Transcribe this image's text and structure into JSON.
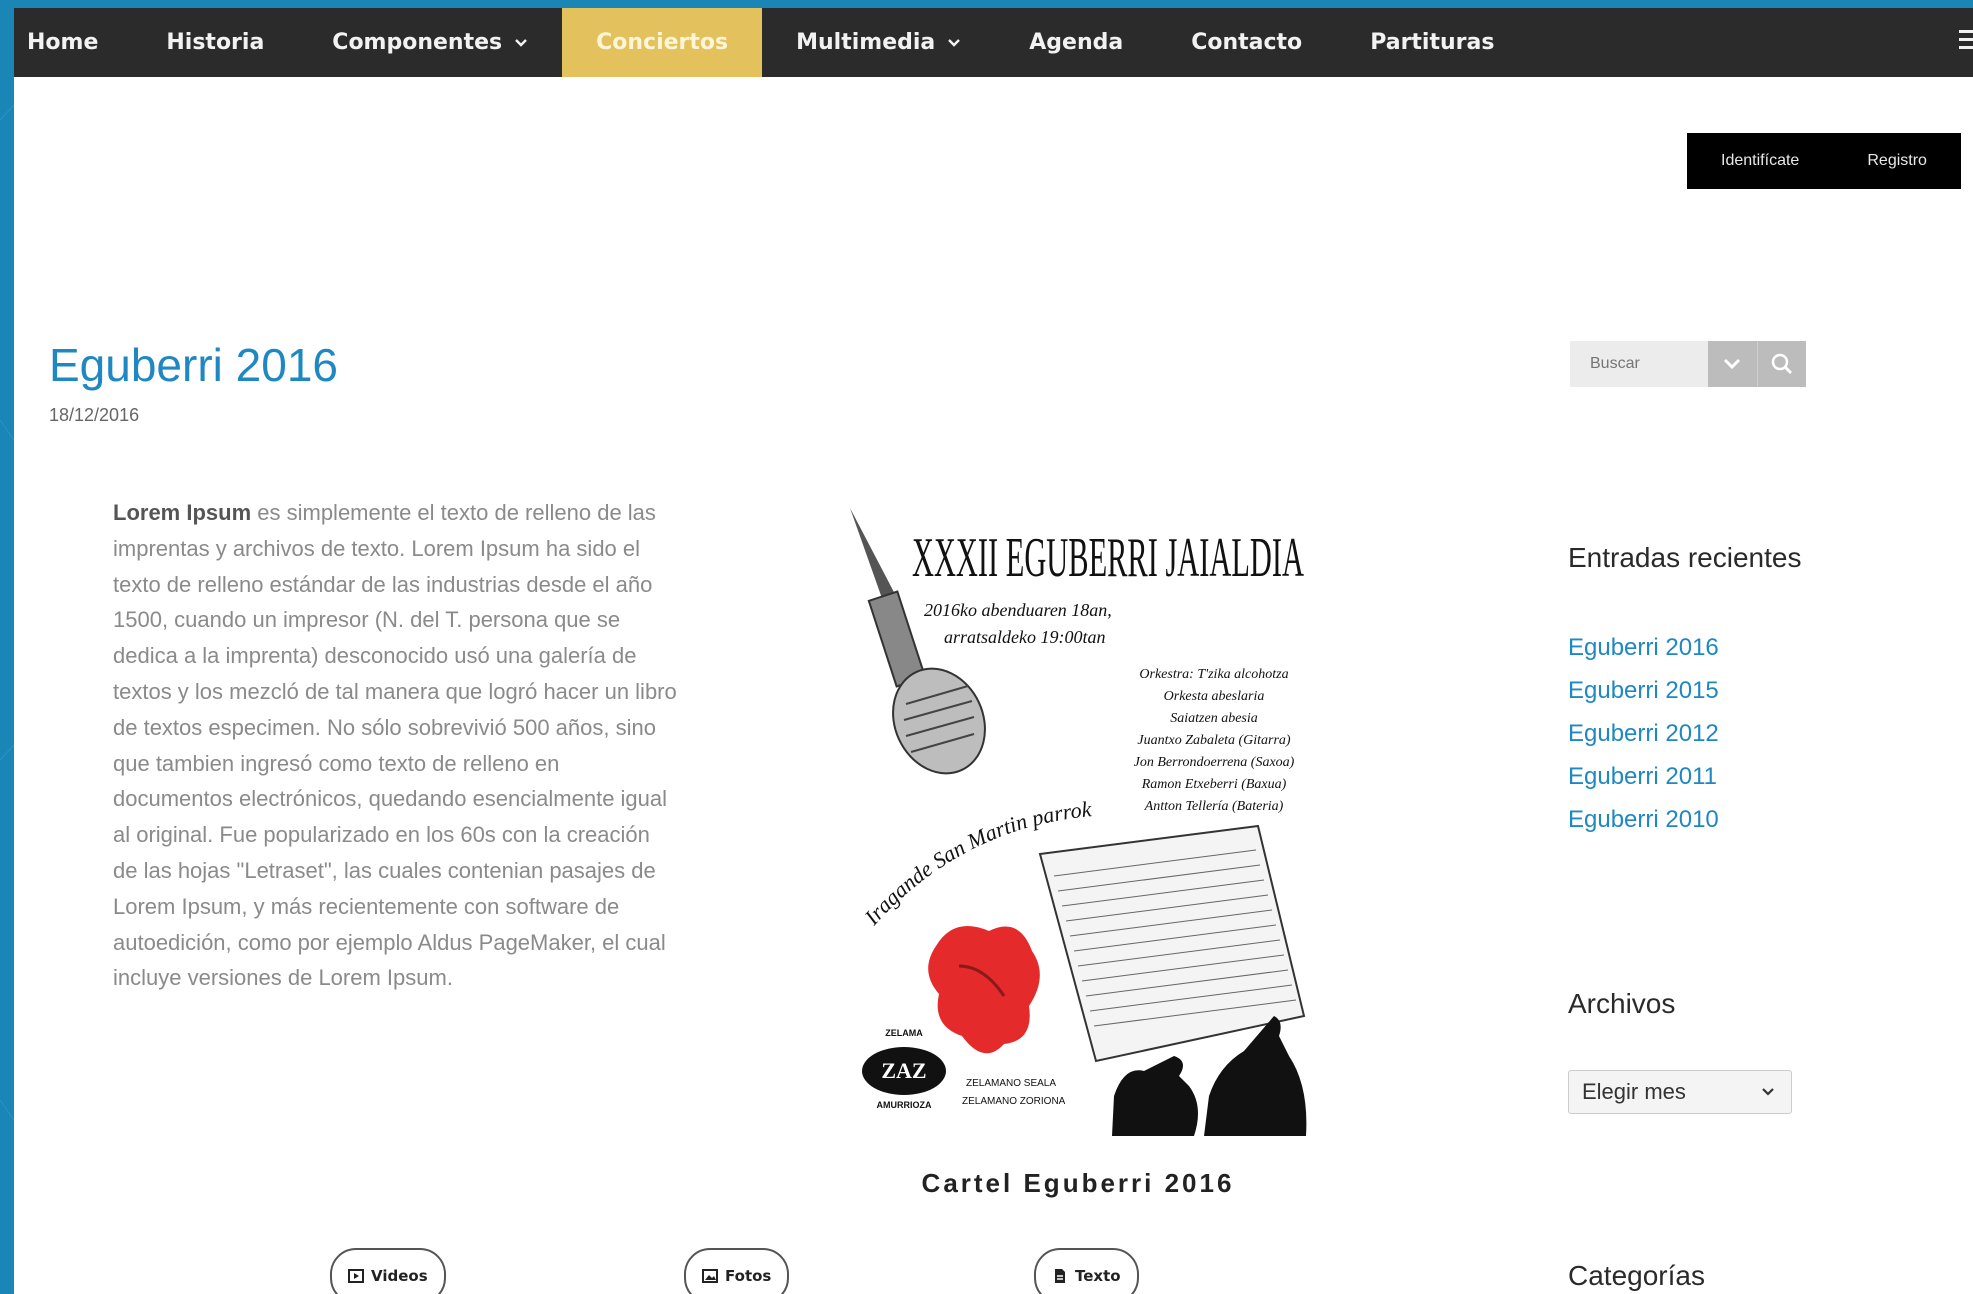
{
  "nav": {
    "items": [
      {
        "label": "Home",
        "dropdown": false,
        "active": false
      },
      {
        "label": "Historia",
        "dropdown": false,
        "active": false
      },
      {
        "label": "Componentes",
        "dropdown": true,
        "active": false
      },
      {
        "label": "Conciertos",
        "dropdown": false,
        "active": true
      },
      {
        "label": "Multimedia",
        "dropdown": true,
        "active": false
      },
      {
        "label": "Agenda",
        "dropdown": false,
        "active": false
      },
      {
        "label": "Contacto",
        "dropdown": false,
        "active": false
      },
      {
        "label": "Partituras",
        "dropdown": false,
        "active": false
      }
    ],
    "menu_icon": "hamburger-icon"
  },
  "auth": {
    "login_label": "Identifícate",
    "register_label": "Registro"
  },
  "post": {
    "title": "Eguberri 2016",
    "date": "18/12/2016",
    "body_bold": "Lorem Ipsum",
    "body_rest": " es simplemente el texto de relleno de las imprentas y archivos de texto. Lorem Ipsum ha sido el texto de relleno estándar de las industrias desde el año 1500, cuando un impresor (N. del T. persona que se dedica a la imprenta) desconocido usó una galería de textos y los mezcló de tal manera que logró hacer un libro de textos especimen. No sólo sobrevivió 500 años, sino que tambien ingresó como texto de relleno en documentos electrónicos, quedando esencialmente igual al original. Fue popularizado en los 60s con la creación de las hojas \"Letraset\", las cuales contenian pasajes de Lorem Ipsum, y más recientemente con software de autoedición, como por ejemplo Aldus PageMaker, el cual incluye versiones de Lorem Ipsum.",
    "poster": {
      "heading": "XXXII EGUBERRI JAIALDIA",
      "line1": "2016ko abenduaren 18an,",
      "line2": "arratsaldeko 19:00tan",
      "credits": [
        "Orkestra: T'zika alcohotza",
        "Orkesta abeslaria",
        "Saiatzen abesia",
        "Juantxo Zabaleta (Gitarra)",
        "Jon Berrondoerrena (Saxoa)",
        "Ramon Etxeberri (Baxua)",
        "Antton Tellería (Bateria)"
      ],
      "curved_text": "Iragande San Martin parrokian",
      "logo_text_top": "ZELAMA",
      "logo_text_bottom": "AMURRIOZA",
      "logo_mark": "ZAZ",
      "footnote1": "ZELAMANO SEALA",
      "footnote2": "ZELAMANO ZORIONA"
    },
    "caption": "Cartel Eguberri 2016"
  },
  "media_buttons": [
    {
      "label": "Videos",
      "icon": "video-icon"
    },
    {
      "label": "Fotos",
      "icon": "photo-icon"
    },
    {
      "label": "Texto",
      "icon": "document-icon"
    }
  ],
  "sidebar": {
    "search_placeholder": "Buscar",
    "recent_title": "Entradas recientes",
    "recent": [
      "Eguberri 2016",
      "Eguberri 2015",
      "Eguberri 2012",
      "Eguberri 2011",
      "Eguberri 2010"
    ],
    "archives_title": "Archivos",
    "archives_select": "Elegir mes",
    "categories_title": "Categorías"
  },
  "colors": {
    "page_background": "#1a86b6",
    "nav_background": "#2b2b2b",
    "nav_active": "#e3c15c",
    "link": "#1f88c2"
  }
}
